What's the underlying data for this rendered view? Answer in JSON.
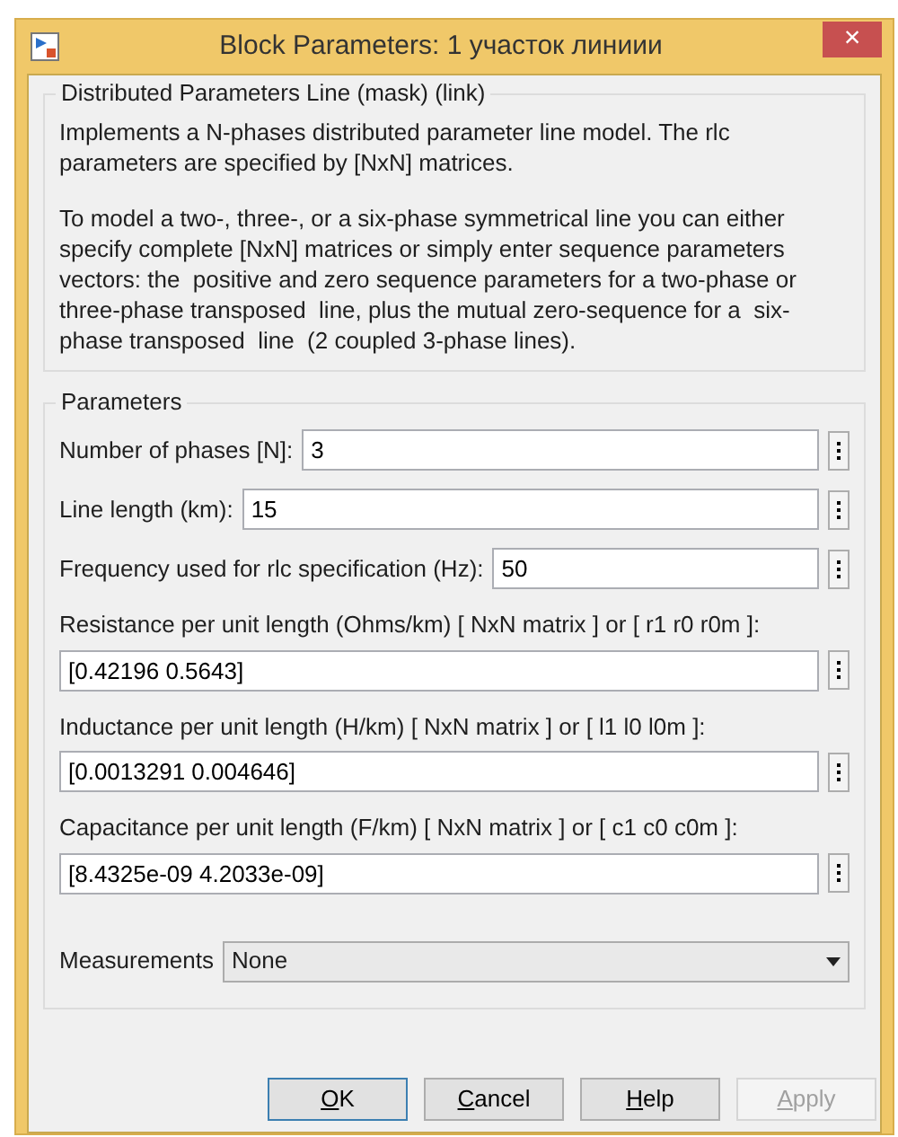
{
  "window": {
    "title": "Block Parameters: 1 участок линиии",
    "close": "×"
  },
  "description": {
    "title": "Distributed Parameters Line (mask) (link)",
    "paragraphs": [
      "Implements a N-phases distributed parameter line model. The rlc parameters are specified by [NxN] matrices.",
      "To model a two-, three-, or a six-phase symmetrical line you can either specify complete [NxN] matrices or simply enter sequence parameters vectors: the  positive and zero sequence parameters for a two-phase or three-phase transposed  line, plus the mutual zero-sequence for a  six-phase transposed  line  (2 coupled 3-phase lines)."
    ]
  },
  "parameters": {
    "title": "Parameters",
    "fields": [
      {
        "kind": "inline",
        "label": "Number of phases [N]:",
        "value": "3"
      },
      {
        "kind": "inline",
        "label": "Line length (km):",
        "value": "15"
      },
      {
        "kind": "inline",
        "label": "Frequency used for rlc specification (Hz):",
        "value": "50"
      },
      {
        "kind": "stacked",
        "label": "Resistance per unit length (Ohms/km) [ NxN matrix ] or [ r1 r0 r0m ]:",
        "value": "[0.42196 0.5643]"
      },
      {
        "kind": "stacked",
        "label": "Inductance per unit length (H/km) [ NxN matrix ] or [ l1 l0 l0m ]:",
        "value": "[0.0013291 0.004646]"
      },
      {
        "kind": "stacked",
        "label": "Capacitance per unit length (F/km) [ NxN matrix ] or [ c1 c0 c0m ]:",
        "value": "[8.4325e-09 4.2033e-09]"
      }
    ],
    "measurements": {
      "label": "Measurements",
      "value": "None"
    }
  },
  "buttons": [
    {
      "label": "OK",
      "disabled": false,
      "default": true
    },
    {
      "label": "Cancel",
      "disabled": false,
      "default": false
    },
    {
      "label": "Help",
      "disabled": false,
      "default": false
    },
    {
      "label": "Apply",
      "disabled": true,
      "default": false
    }
  ]
}
